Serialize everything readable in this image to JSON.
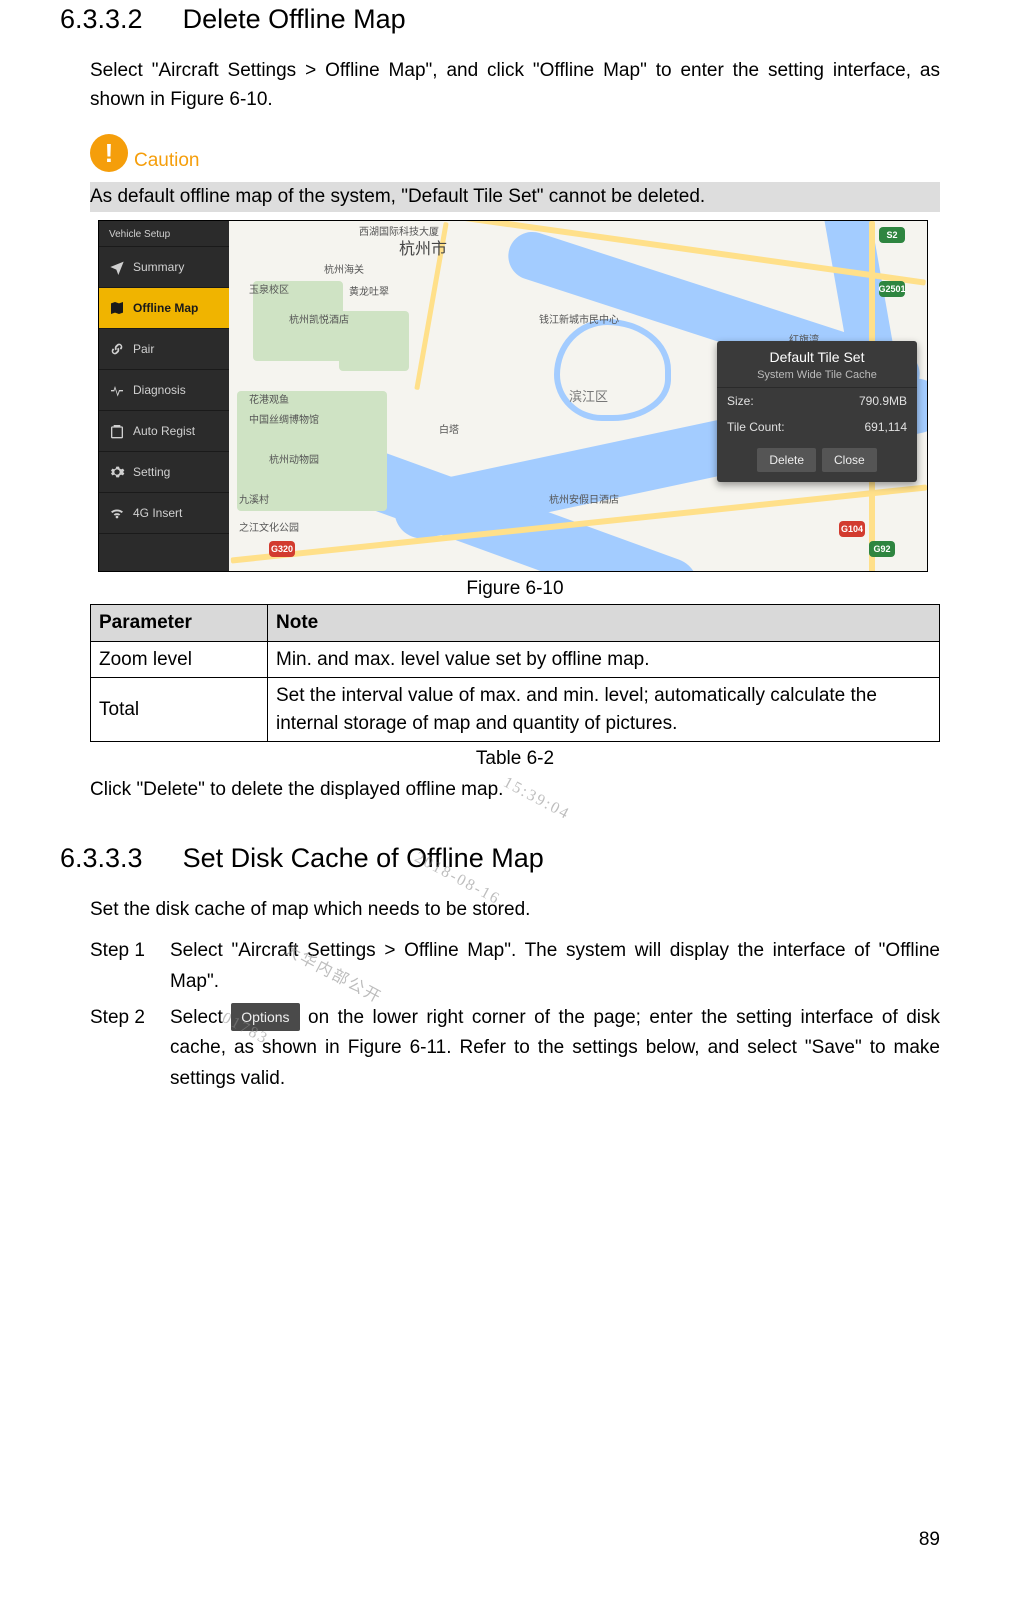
{
  "section6332": {
    "number": "6.3.3.2",
    "title": "Delete Offline Map",
    "intro": "Select \"Aircraft Settings > Offline Map\", and click \"Offline Map\" to enter the setting interface, as shown in Figure 6-10.",
    "caution_label": "Caution",
    "caution_text": "As default offline map of the system, \"Default Tile Set\" cannot be deleted.",
    "figure_caption": "Figure 6-10",
    "table_caption": "Table 6-2",
    "table": {
      "header_param": "Parameter",
      "header_note": "Note",
      "rows": [
        {
          "param": "Zoom level",
          "note": "Min. and max. level value set by offline map."
        },
        {
          "param": "Total",
          "note": "Set the interval value of max. and min. level; automatically calculate the internal storage of map and quantity of pictures."
        }
      ]
    },
    "after_table": "Click \"Delete\" to delete the displayed offline map."
  },
  "screenshot": {
    "sidebar_header": "Vehicle Setup",
    "items": [
      {
        "label": "Summary"
      },
      {
        "label": "Offline Map"
      },
      {
        "label": "Pair"
      },
      {
        "label": "Diagnosis"
      },
      {
        "label": "Auto Regist"
      },
      {
        "label": "Setting"
      },
      {
        "label": "4G Insert"
      }
    ],
    "map_labels": {
      "city": "杭州市",
      "l1": "西湖国际科技大厦",
      "l2": "杭州海关",
      "l3": "玉泉校区",
      "l4": "黄龙吐翠",
      "l5": "杭州凯悦酒店",
      "l6": "花港观鱼",
      "l7": "中国丝绸博物馆",
      "l8": "杭州动物园",
      "l9": "九溪村",
      "l10": "之江文化公园",
      "l11": "钱江新城市民中心",
      "l12": "滨江区",
      "l13": "白塔",
      "l14": "红旗湾",
      "l15": "杭州安假日酒店"
    },
    "shields": {
      "s1": "S2",
      "s2": "G104",
      "s3": "G2501",
      "s4": "G320",
      "s5": "G104",
      "s6": "G92"
    },
    "popup": {
      "title": "Default Tile Set",
      "subtitle": "System Wide Tile Cache",
      "size_label": "Size:",
      "size_value": "790.9MB",
      "count_label": "Tile Count:",
      "count_value": "691,114",
      "btn_delete": "Delete",
      "btn_close": "Close"
    }
  },
  "section6333": {
    "number": "6.3.3.3",
    "title": "Set Disk Cache of Offline Map",
    "intro": "Set the disk cache of map which needs to be stored.",
    "step1_label": "Step 1",
    "step1_text": "Select \"Aircraft Settings > Offline Map\". The system will display the interface of \"Offline Map\".",
    "step2_label": "Step 2",
    "step2_pre": "Select ",
    "options_chip": "Options",
    "step2_post": " on the lower right corner of the page; enter the setting interface of disk cache, as shown in Figure 6-11. Refer to the settings below, and select \"Save\" to make settings valid."
  },
  "watermark": {
    "a": "大华内部公开",
    "b": "01783",
    "c": "2018-08-16",
    "d": "15:39:04"
  },
  "page_number": "89"
}
